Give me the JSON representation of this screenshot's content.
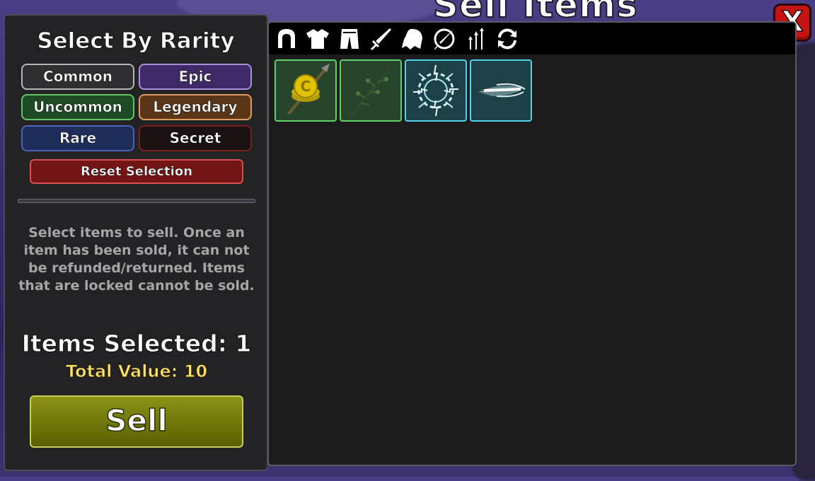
{
  "window": {
    "title": "Sell Items",
    "close_label": "X"
  },
  "rarity": {
    "title": "Select By Rarity",
    "buttons": {
      "common": "Common",
      "epic": "Epic",
      "uncommon": "Uncommon",
      "legendary": "Legendary",
      "rare": "Rare",
      "secret": "Secret"
    },
    "reset_label": "Reset Selection"
  },
  "info": {
    "text": "Select items to sell. Once an item has been sold, it can not be refunded/returned. Items that are locked cannot be sold."
  },
  "summary": {
    "items_selected": "Items Selected: 1",
    "total_value": "Total Value: 10"
  },
  "sell_label": "Sell",
  "tabs": [
    {
      "icon": "helmet-icon"
    },
    {
      "icon": "shirt-icon"
    },
    {
      "icon": "pants-icon"
    },
    {
      "icon": "sword-icon"
    },
    {
      "icon": "cape-icon"
    },
    {
      "icon": "ability-icon"
    },
    {
      "icon": "upgrade-arrows-icon"
    },
    {
      "icon": "refresh-icon"
    }
  ],
  "items": [
    {
      "icon": "coin-spear-icon",
      "rarity": "uncommon",
      "coin_letter": "C"
    },
    {
      "icon": "branch-staff-icon",
      "rarity": "uncommon"
    },
    {
      "icon": "lightning-ring-icon",
      "rarity": "rare"
    },
    {
      "icon": "dash-streak-icon",
      "rarity": "rare"
    }
  ],
  "colors": {
    "sell": "#7a8010",
    "total_value": "#ffe36b",
    "close": "#c41414"
  }
}
